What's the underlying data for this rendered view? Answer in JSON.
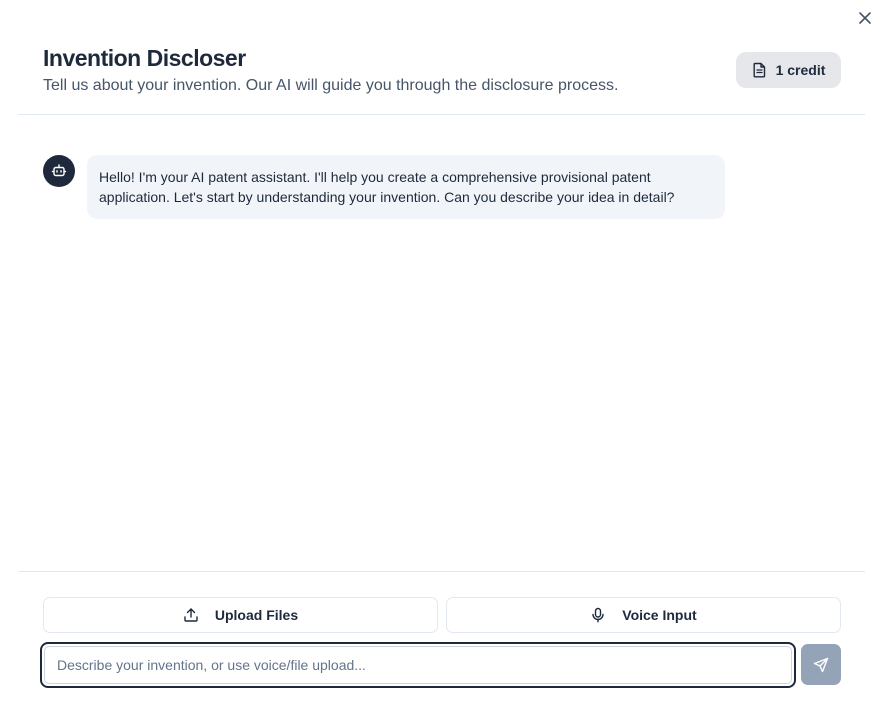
{
  "dialog": {
    "close_icon": "x-icon"
  },
  "header": {
    "title": "Invention Discloser",
    "subtitle": "Tell us about your invention. Our AI will guide you through the disclosure process.",
    "credit": {
      "icon": "document-icon",
      "label": "1 credit"
    }
  },
  "messages": [
    {
      "role": "assistant",
      "avatar_icon": "bot-icon",
      "text": "Hello! I'm your AI patent assistant. I'll help you create a comprehensive provisional patent application. Let's start by understanding your invention. Can you describe your idea in detail?"
    }
  ],
  "footer": {
    "upload_button": {
      "icon": "upload-icon",
      "label": "Upload Files"
    },
    "voice_button": {
      "icon": "microphone-icon",
      "label": "Voice Input"
    },
    "input": {
      "value": "",
      "placeholder": "Describe your invention, or use voice/file upload..."
    },
    "send_button": {
      "icon": "send-icon"
    }
  },
  "colors": {
    "primary": "#1e293b",
    "send_disabled": "#94a3b8",
    "bubble_bg": "#f1f5f9",
    "badge_bg": "#e5e7eb",
    "border": "#e2e8f0"
  }
}
